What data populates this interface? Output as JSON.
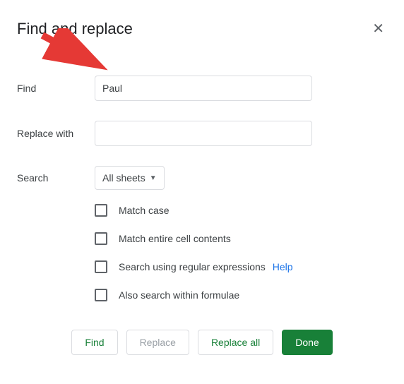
{
  "dialog": {
    "title": "Find and replace"
  },
  "fields": {
    "find_label": "Find",
    "find_value": "Paul",
    "replace_label": "Replace with",
    "replace_value": "",
    "search_label": "Search",
    "search_scope": "All sheets"
  },
  "options": {
    "match_case": "Match case",
    "match_entire": "Match entire cell contents",
    "regex": "Search using regular expressions",
    "regex_help": "Help",
    "formulae": "Also search within formulae"
  },
  "buttons": {
    "find": "Find",
    "replace": "Replace",
    "replace_all": "Replace all",
    "done": "Done"
  }
}
